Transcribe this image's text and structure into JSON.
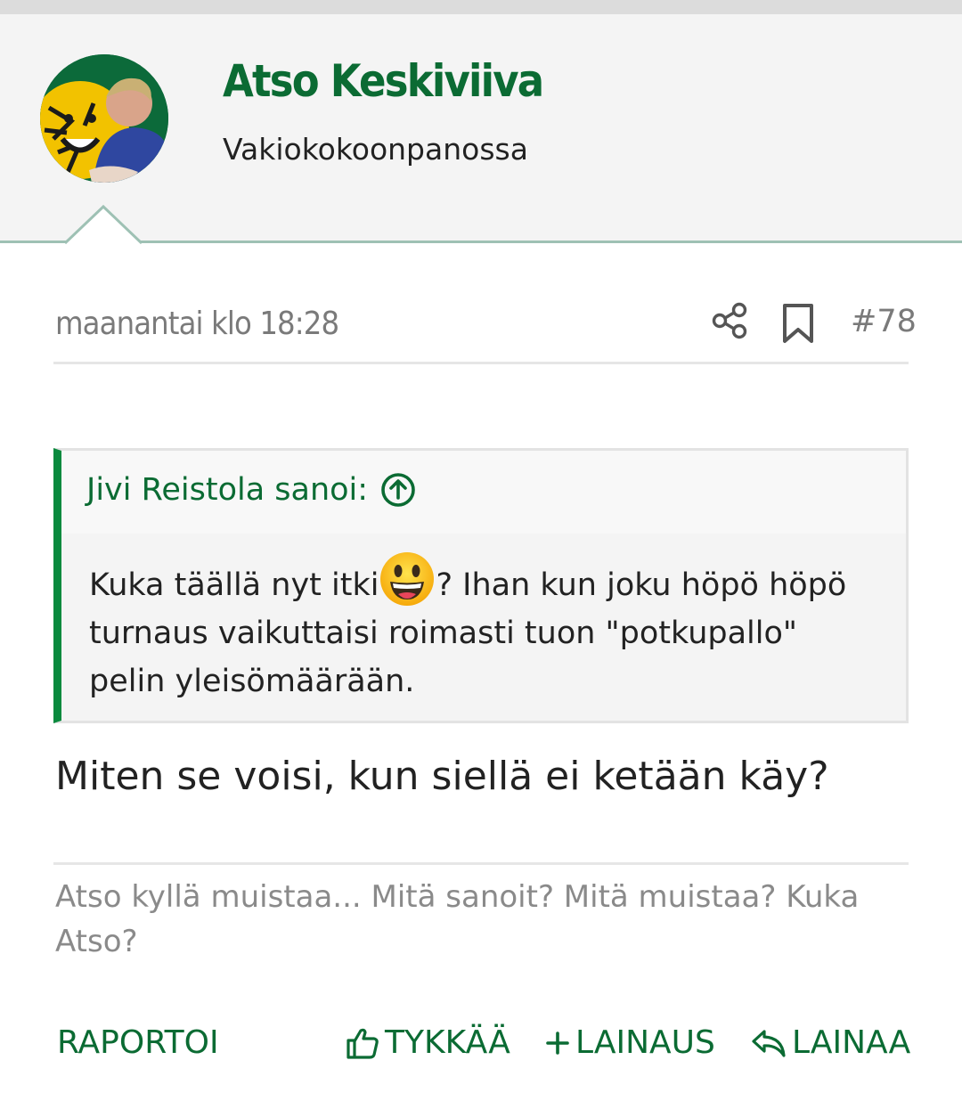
{
  "author": {
    "name": "Atso Keskiviiva",
    "title": "Vakiokokoonpanossa"
  },
  "post": {
    "date": "maanantai klo 18:28",
    "number": "#78",
    "quote": {
      "author": "Jivi Reistola sanoi:",
      "text_before_emoji": "Kuka täällä nyt itki",
      "text_after_emoji": "? Ihan kun joku höpö höpö turnaus vaikuttaisi roimasti tuon \"potkupallo\" pelin yleisömäärään."
    },
    "body": "Miten se voisi, kun siellä ei ketään käy?",
    "signature": "Atso kyllä muistaa... Mitä sanoit? Mitä muistaa? Kuka Atso?"
  },
  "actions": {
    "report": "RAPORTOI",
    "like": "TYKKÄÄ",
    "multiquote": "LAINAUS",
    "quote": "LAINAA"
  },
  "icons": {
    "share": "share-icon",
    "bookmark": "bookmark-icon",
    "jump_to_quote": "arrow-up-circle-icon",
    "emoji": "grinning-face-icon",
    "like": "thumbs-up-icon",
    "multiquote": "plus-icon",
    "quote": "reply-icon"
  },
  "colors": {
    "accent_green": "#0b6b33",
    "quote_bar": "#0a8a3e",
    "header_bg": "#f4f4f4",
    "muted_text": "#7a7a7a"
  }
}
